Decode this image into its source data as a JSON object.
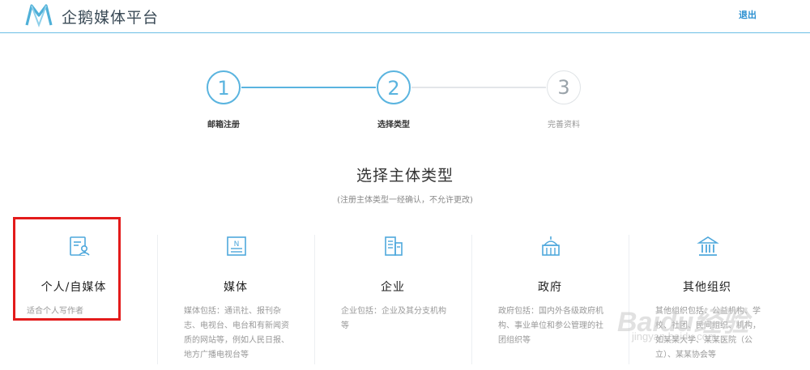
{
  "header": {
    "brand": "企鹅媒体平台",
    "logout": "退出",
    "logo_icon": "penguin-m-logo-icon"
  },
  "steps": [
    {
      "number": "1",
      "label": "邮箱注册",
      "state": "done"
    },
    {
      "number": "2",
      "label": "选择类型",
      "state": "current"
    },
    {
      "number": "3",
      "label": "完善资料",
      "state": "todo"
    }
  ],
  "main": {
    "title": "选择主体类型",
    "subtitle": "(注册主体类型一经确认，不允许更改)"
  },
  "cards": [
    {
      "icon": "profile-card-icon",
      "name": "个人/自媒体",
      "desc": "适合个人写作者"
    },
    {
      "icon": "newspaper-icon",
      "name": "媒体",
      "desc": "媒体包括：通讯社、报刊杂志、电视台、电台和有新闻资质的网站等，例如人民日报、地方广播电视台等"
    },
    {
      "icon": "building-icon",
      "name": "企业",
      "desc": "企业包括：企业及其分支机构等"
    },
    {
      "icon": "government-building-icon",
      "name": "政府",
      "desc": "政府包括：国内外各级政府机构、事业单位和参公管理的社团组织等"
    },
    {
      "icon": "institution-icon",
      "name": "其他组织",
      "desc": "其他组织包括：公益机构、学校、社团、民间组织、机构，如某某大学、某某医院（公立）、某某协会等"
    }
  ],
  "watermark": {
    "text": "Baidu经验",
    "url_text": "jingyan.baidu.com"
  },
  "colors": {
    "accent": "#5ab4df",
    "highlight": "#e31b1b"
  }
}
